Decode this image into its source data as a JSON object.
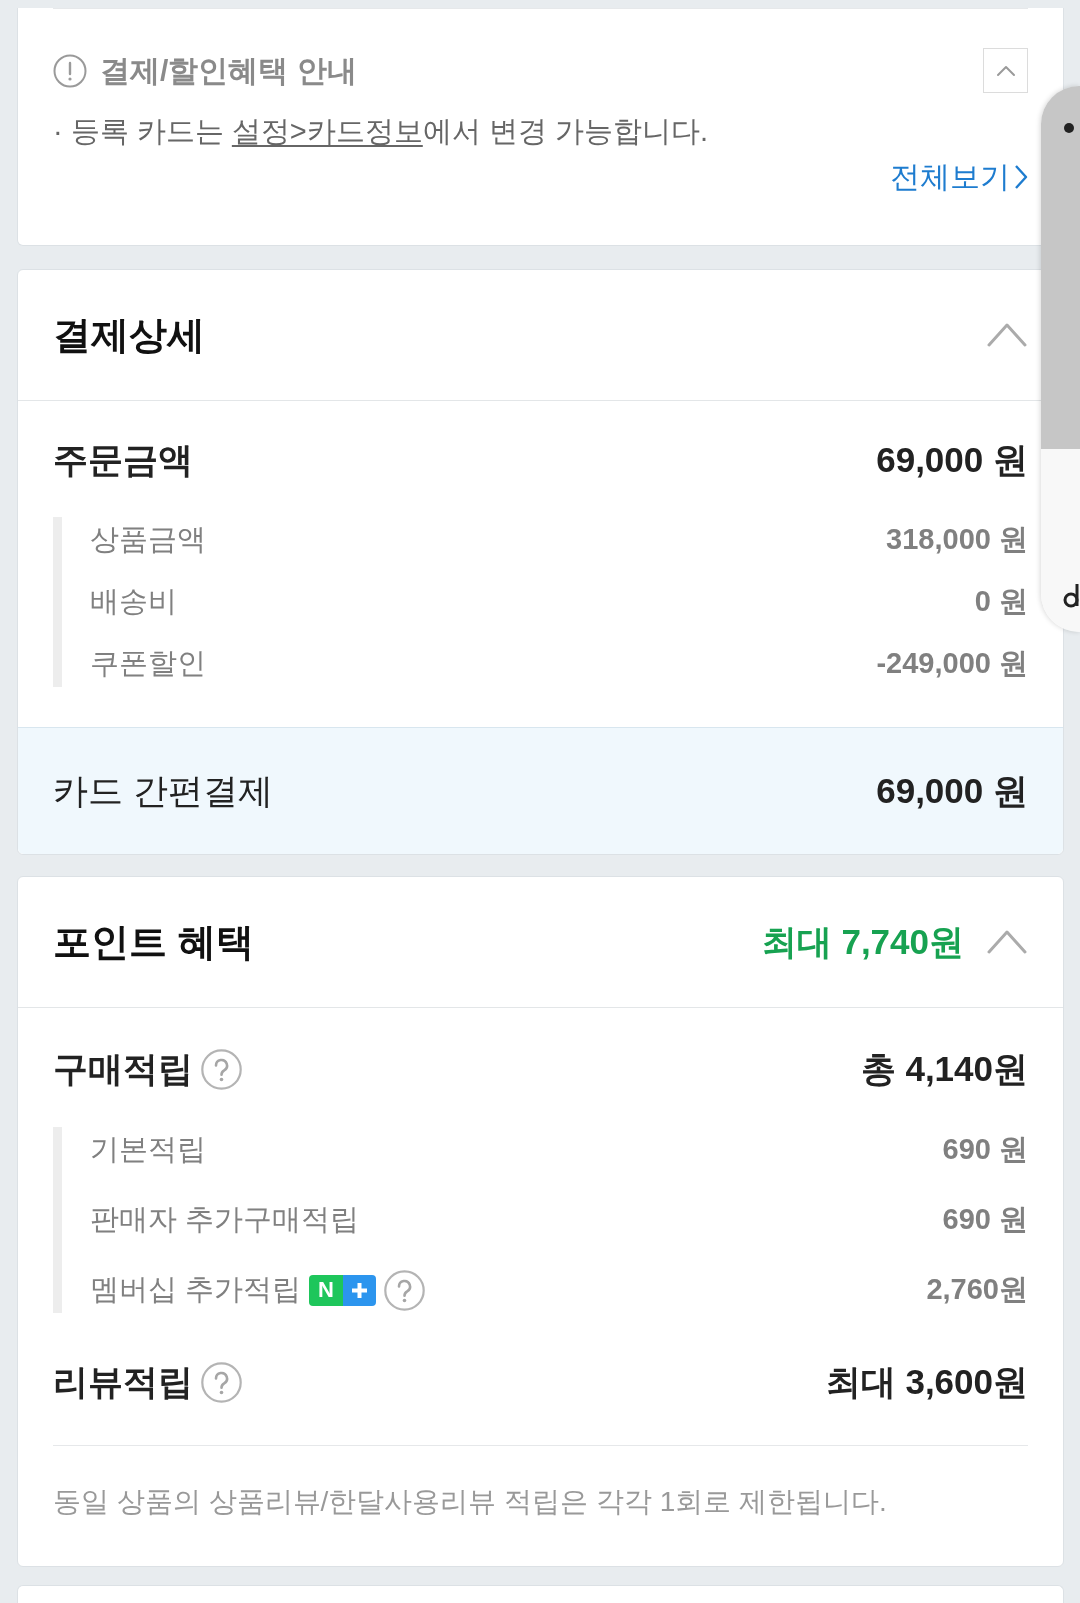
{
  "notice_card": {
    "title": "결제/할인혜택 안내",
    "expanded": true,
    "notice": {
      "before": "· 등록 카드는 ",
      "link": "설정>카드정보",
      "after": "에서 변경 가능합니다."
    },
    "view_all": "전체보기"
  },
  "payment_detail": {
    "title": "결제상세",
    "expanded": true,
    "order": {
      "label": "주문금액",
      "value": "69,000 원"
    },
    "items": [
      {
        "label": "상품금액",
        "value": "318,000 원"
      },
      {
        "label": "배송비",
        "value": "0 원"
      },
      {
        "label": "쿠폰할인",
        "value": "-249,000 원"
      }
    ],
    "method": {
      "label": "카드 간편결제",
      "value": "69,000 원"
    }
  },
  "point_benefit": {
    "title": "포인트 혜택",
    "summary": "최대 7,740원",
    "expanded": true,
    "groups": [
      {
        "label": "구매적립",
        "help": true,
        "value": "총 4,140원",
        "items": [
          {
            "label": "기본적립",
            "help": false,
            "value": "690 원"
          },
          {
            "label": "판매자 추가구매적립",
            "help": false,
            "value": "690 원"
          },
          {
            "label": "멤버십 추가적립",
            "badge": "N",
            "help": true,
            "value": "2,760원"
          }
        ]
      },
      {
        "label": "리뷰적립",
        "help": true,
        "value": "최대 3,600원"
      }
    ],
    "note": "동일 상품의 상품리뷰/한달사용리뷰 적립은 각각 1회로 제한됩니다."
  }
}
